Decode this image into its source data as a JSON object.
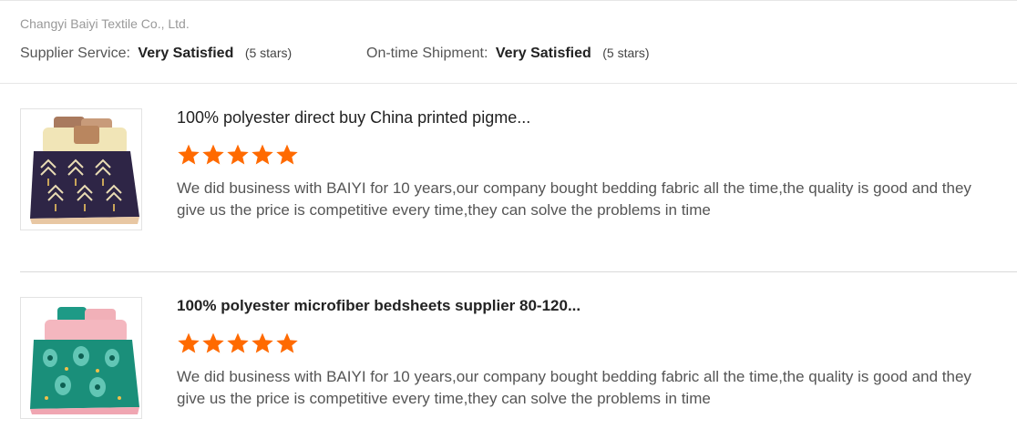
{
  "supplier": {
    "company_name": "Changyi Baiyi Textile Co., Ltd.",
    "ratings": [
      {
        "label": "Supplier Service:",
        "value": "Very Satisfied",
        "stars_text": "(5 stars)"
      },
      {
        "label": "On-time Shipment:",
        "value": "Very Satisfied",
        "stars_text": "(5 stars)"
      }
    ]
  },
  "reviews": [
    {
      "product_title": "100% polyester direct buy China printed pigme...",
      "star_rating": 5,
      "star_color": "#ff6a00",
      "comment": "We did business with BAIYI for 10 years,our company bought bedding fabric all the time,the quality is good and they give us the price is competitive every time,they can solve the problems in time",
      "image": "purple-arrow-pattern-bedding-set"
    },
    {
      "product_title": "100% polyester microfiber bedsheets supplier 80-120...",
      "star_rating": 5,
      "star_color": "#ff6a00",
      "comment": "We did business with BAIYI for 10 years,our company bought bedding fabric all the time,the quality is good and they give us the price is competitive every time,they can solve the problems in time",
      "image": "green-paisley-pink-bedding-set"
    }
  ]
}
